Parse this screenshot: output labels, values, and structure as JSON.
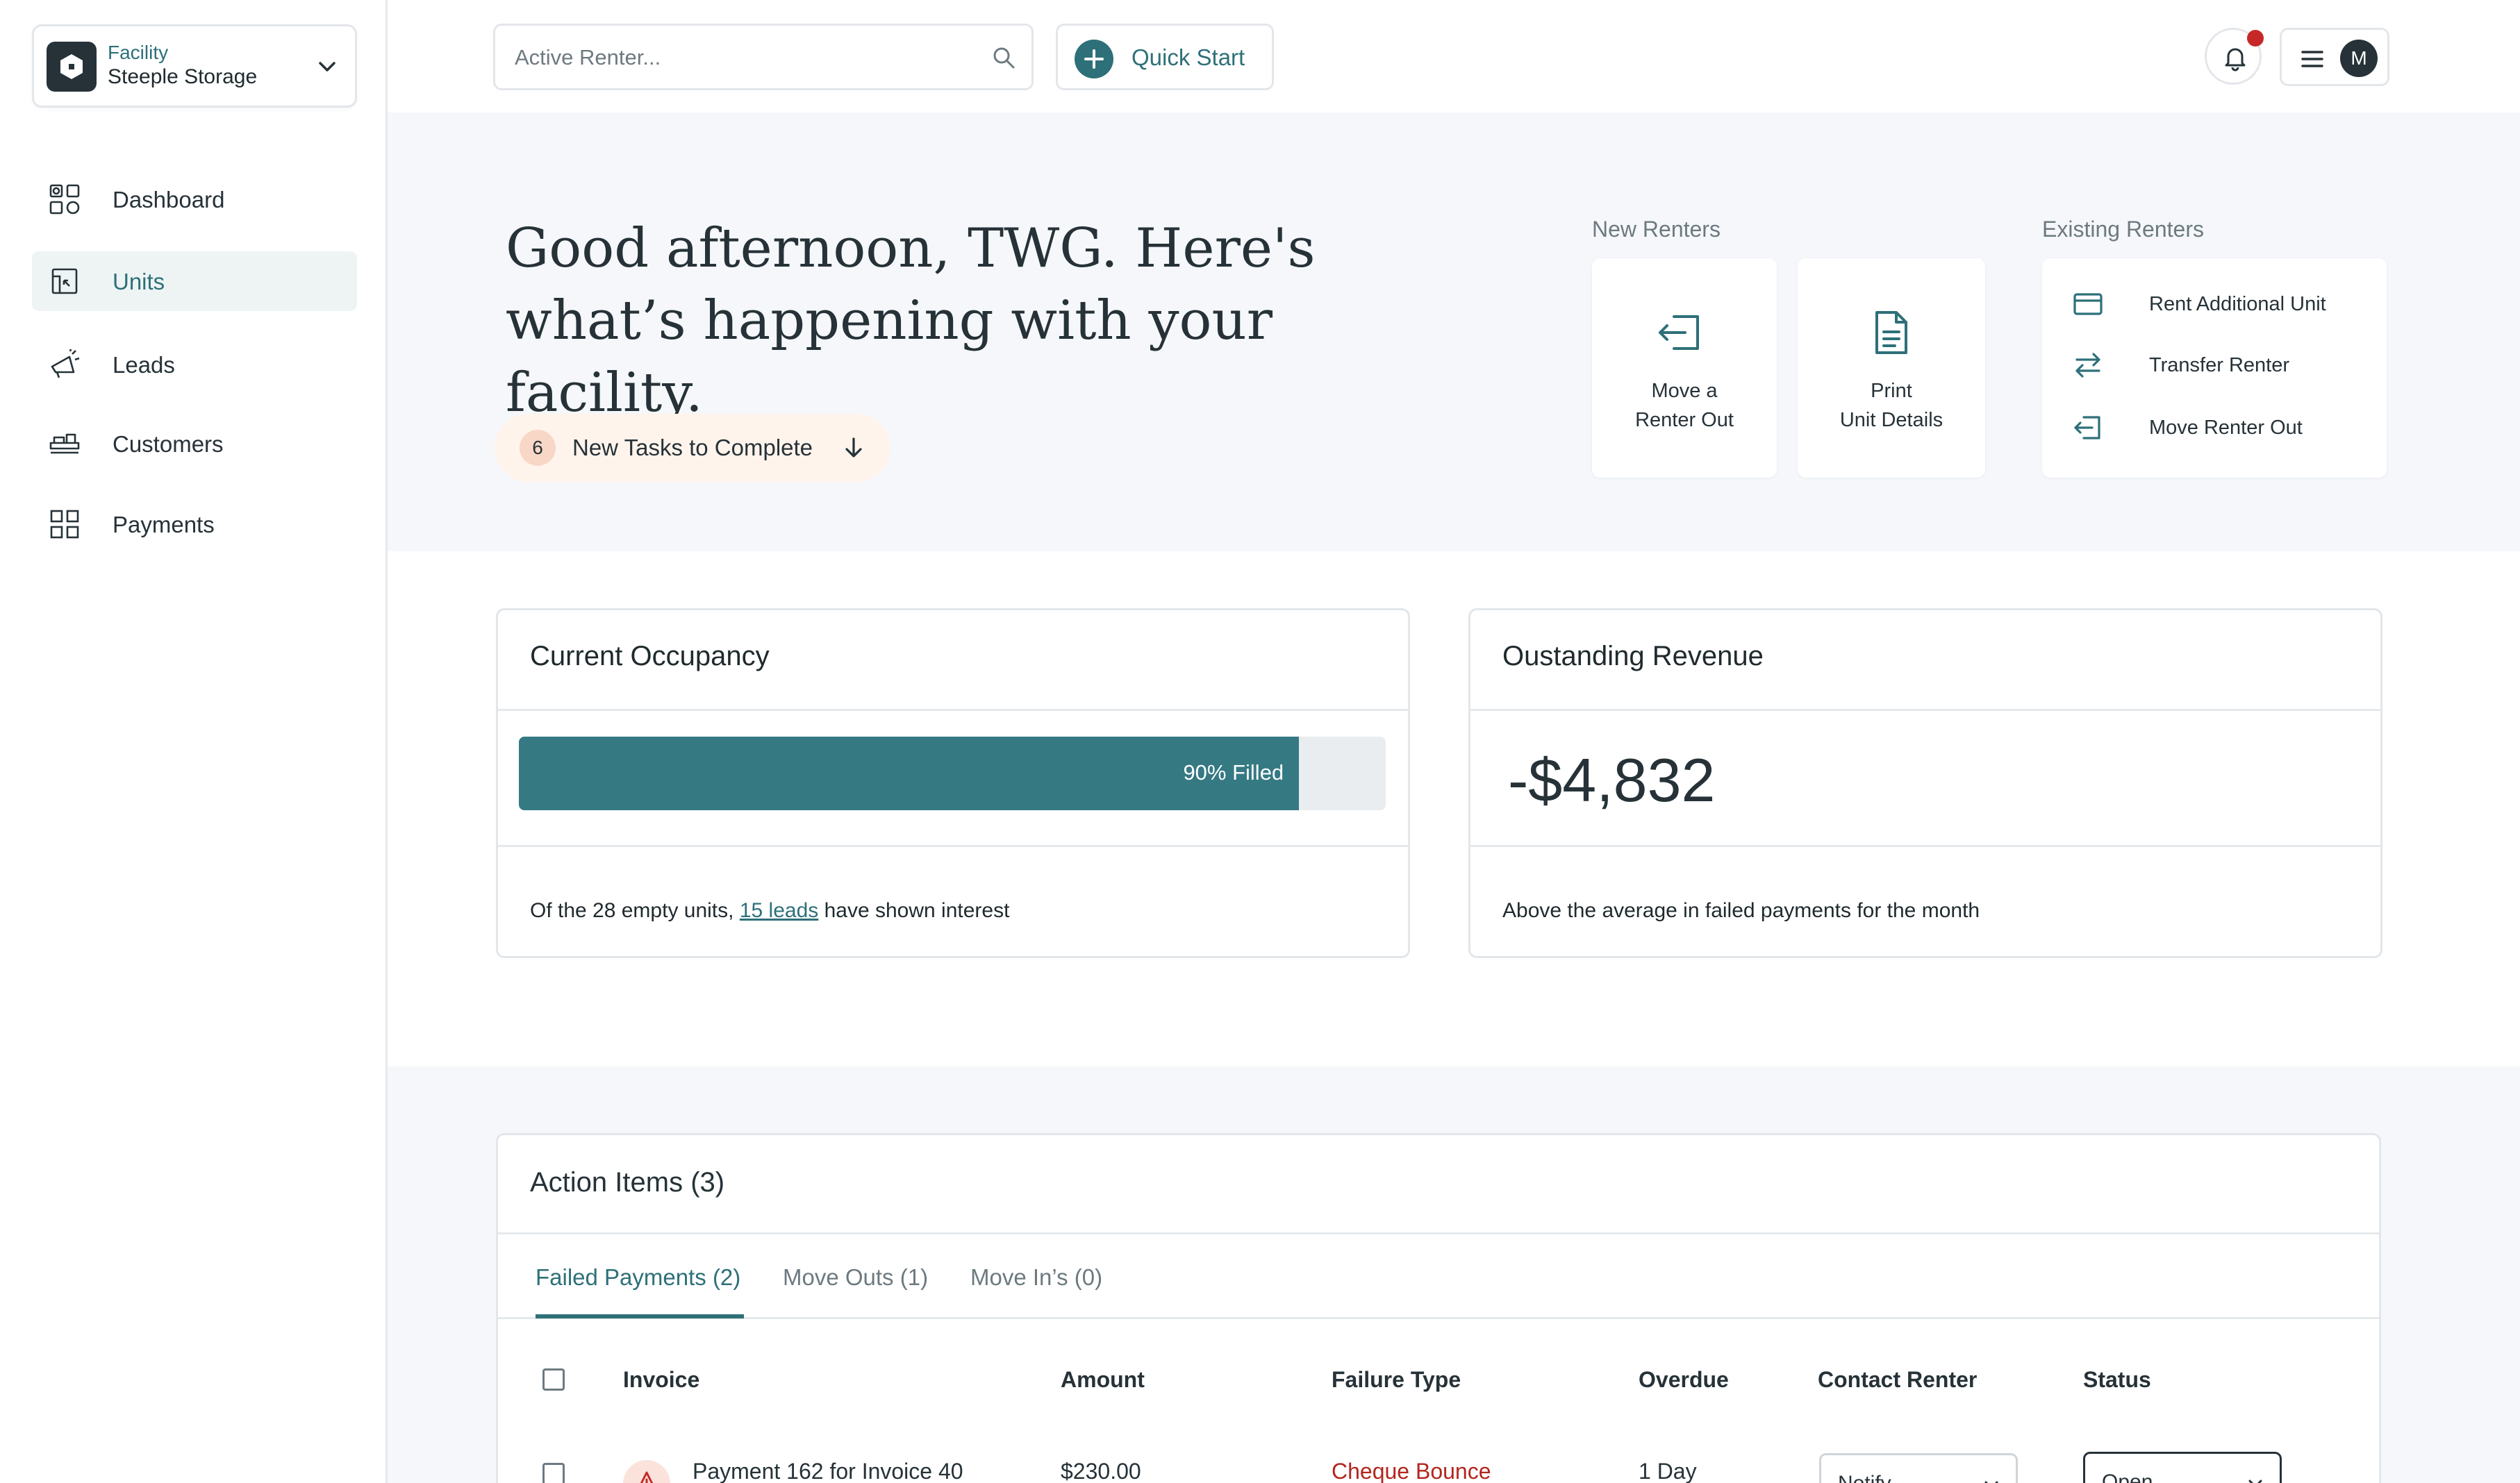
{
  "facility": {
    "label": "Facility",
    "name": "Steeple Storage"
  },
  "nav": [
    {
      "label": "Dashboard",
      "icon": "dashboard-icon"
    },
    {
      "label": "Units",
      "icon": "units-icon",
      "active": true
    },
    {
      "label": "Leads",
      "icon": "megaphone-icon"
    },
    {
      "label": "Customers",
      "icon": "customers-icon"
    },
    {
      "label": "Payments",
      "icon": "grid-icon"
    }
  ],
  "search": {
    "placeholder": "Active Renter..."
  },
  "quick_start": {
    "label": "Quick Start"
  },
  "user": {
    "initial": "M"
  },
  "hero": {
    "greeting": "Good afternoon, TWG. Here's what’s happening with your facility.",
    "tasks_count": "6",
    "tasks_label": "New Tasks to Complete"
  },
  "new_renters": {
    "title": "New Renters",
    "cards": [
      {
        "line1": "Move a",
        "line2": "Renter Out",
        "icon": "move-out-icon"
      },
      {
        "line1": "Print",
        "line2": "Unit Details",
        "icon": "document-icon"
      }
    ]
  },
  "existing_renters": {
    "title": "Existing Renters",
    "items": [
      {
        "label": "Rent Additional Unit",
        "icon": "credit-card-icon"
      },
      {
        "label": "Transfer Renter",
        "icon": "transfer-icon"
      },
      {
        "label": "Move Renter Out",
        "icon": "move-out-icon"
      }
    ]
  },
  "occupancy": {
    "title": "Current Occupancy",
    "fill_fraction": 0.9,
    "filled_label": "90% Filled",
    "foot_prefix": "Of the 28 empty units, ",
    "foot_link": "15 leads",
    "foot_suffix": " have shown interest"
  },
  "revenue": {
    "title": "Oustanding Revenue",
    "value": "-$4,832",
    "foot": "Above the average in failed payments for the month"
  },
  "action_items": {
    "title": "Action Items (3)",
    "tabs": [
      "Failed Payments (2)",
      "Move Outs (1)",
      "Move In’s (0)"
    ],
    "columns": [
      "Invoice",
      "Amount",
      "Failure Type",
      "Overdue",
      "Contact Renter",
      "Status"
    ],
    "rows": [
      {
        "invoice": "Payment 162 for Invoice 40",
        "amount": "$230.00",
        "failure_type": "Cheque Bounce",
        "overdue": "1 Day",
        "contact": "Notify",
        "status": "Open"
      }
    ]
  },
  "colors": {
    "accent": "#2e7079",
    "bar_fill": "#357983",
    "alert": "#c62828",
    "failure_text": "#b3261e"
  }
}
